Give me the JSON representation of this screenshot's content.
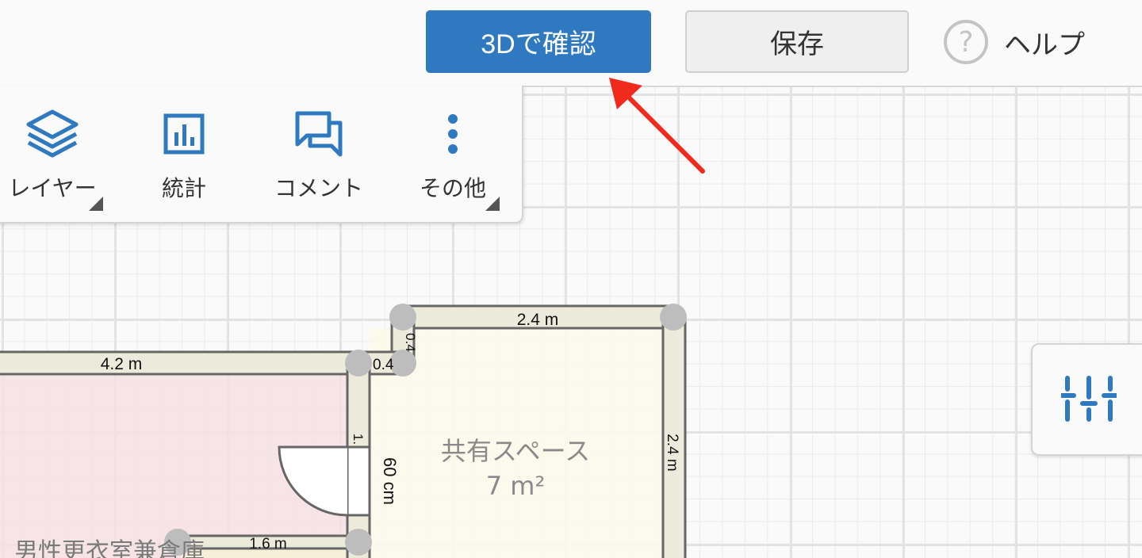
{
  "topbar": {
    "view3d_label": "3Dで確認",
    "save_label": "保存",
    "help_icon": "?",
    "help_label": "ヘルプ"
  },
  "toolbox": {
    "layers_label": "レイヤー",
    "stats_label": "統計",
    "comments_label": "コメント",
    "more_label": "その他"
  },
  "plan": {
    "dim_shared_top": "2.4 m",
    "dim_shared_right": "2.4 m",
    "dim_shared_left_small": "0.4",
    "dim_room_top": "4.2 m",
    "dim_wall_joint": "0.4",
    "dim_wall_middle": "1.",
    "dim_door": "60 cm",
    "dim_bottom": "1.6 m",
    "shared_space_name": "共有スペース",
    "shared_space_area": "7 m²",
    "room_name": "男性更衣室兼倉庫"
  },
  "colors": {
    "accent": "#2f79c0",
    "annotation_arrow": "#f02a1d",
    "room_fill": "#f5dfe3",
    "shared_fill": "#fbf9ea",
    "wall_fill": "#ecebdb"
  }
}
